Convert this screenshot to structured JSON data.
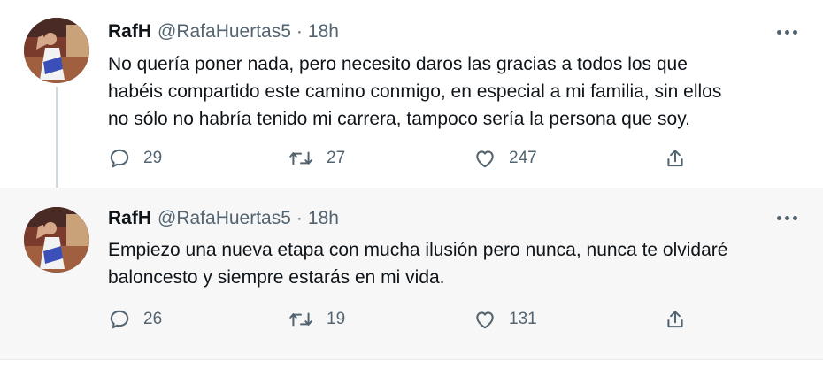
{
  "tweets": [
    {
      "name": "RafH",
      "handle": "@RafaHuertas5",
      "separator": "·",
      "time": "18h",
      "lines": [
        "No quería poner nada, pero necesito daros las gracias a todos los que",
        "habéis compartido este camino conmigo, en especial a mi familia, sin ellos",
        "no sólo no habría tenido mi carrera, tampoco sería la persona que soy."
      ],
      "replies": "29",
      "retweets": "27",
      "likes": "247"
    },
    {
      "name": "RafH",
      "handle": "@RafaHuertas5",
      "separator": "·",
      "time": "18h",
      "lines": [
        "Empiezo una nueva etapa con mucha ilusión pero nunca, nunca te olvidaré",
        "baloncesto y siempre estarás en mi vida."
      ],
      "replies": "26",
      "retweets": "19",
      "likes": "131"
    }
  ],
  "icons": {
    "reply": "reply-icon",
    "retweet": "retweet-icon",
    "like": "heart-icon",
    "share": "share-icon",
    "more": "more-icon"
  },
  "colors": {
    "text": "#0f1419",
    "secondary": "#536471",
    "thread_line": "#cfd9de",
    "second_tweet_bg": "#f7f7f7"
  }
}
